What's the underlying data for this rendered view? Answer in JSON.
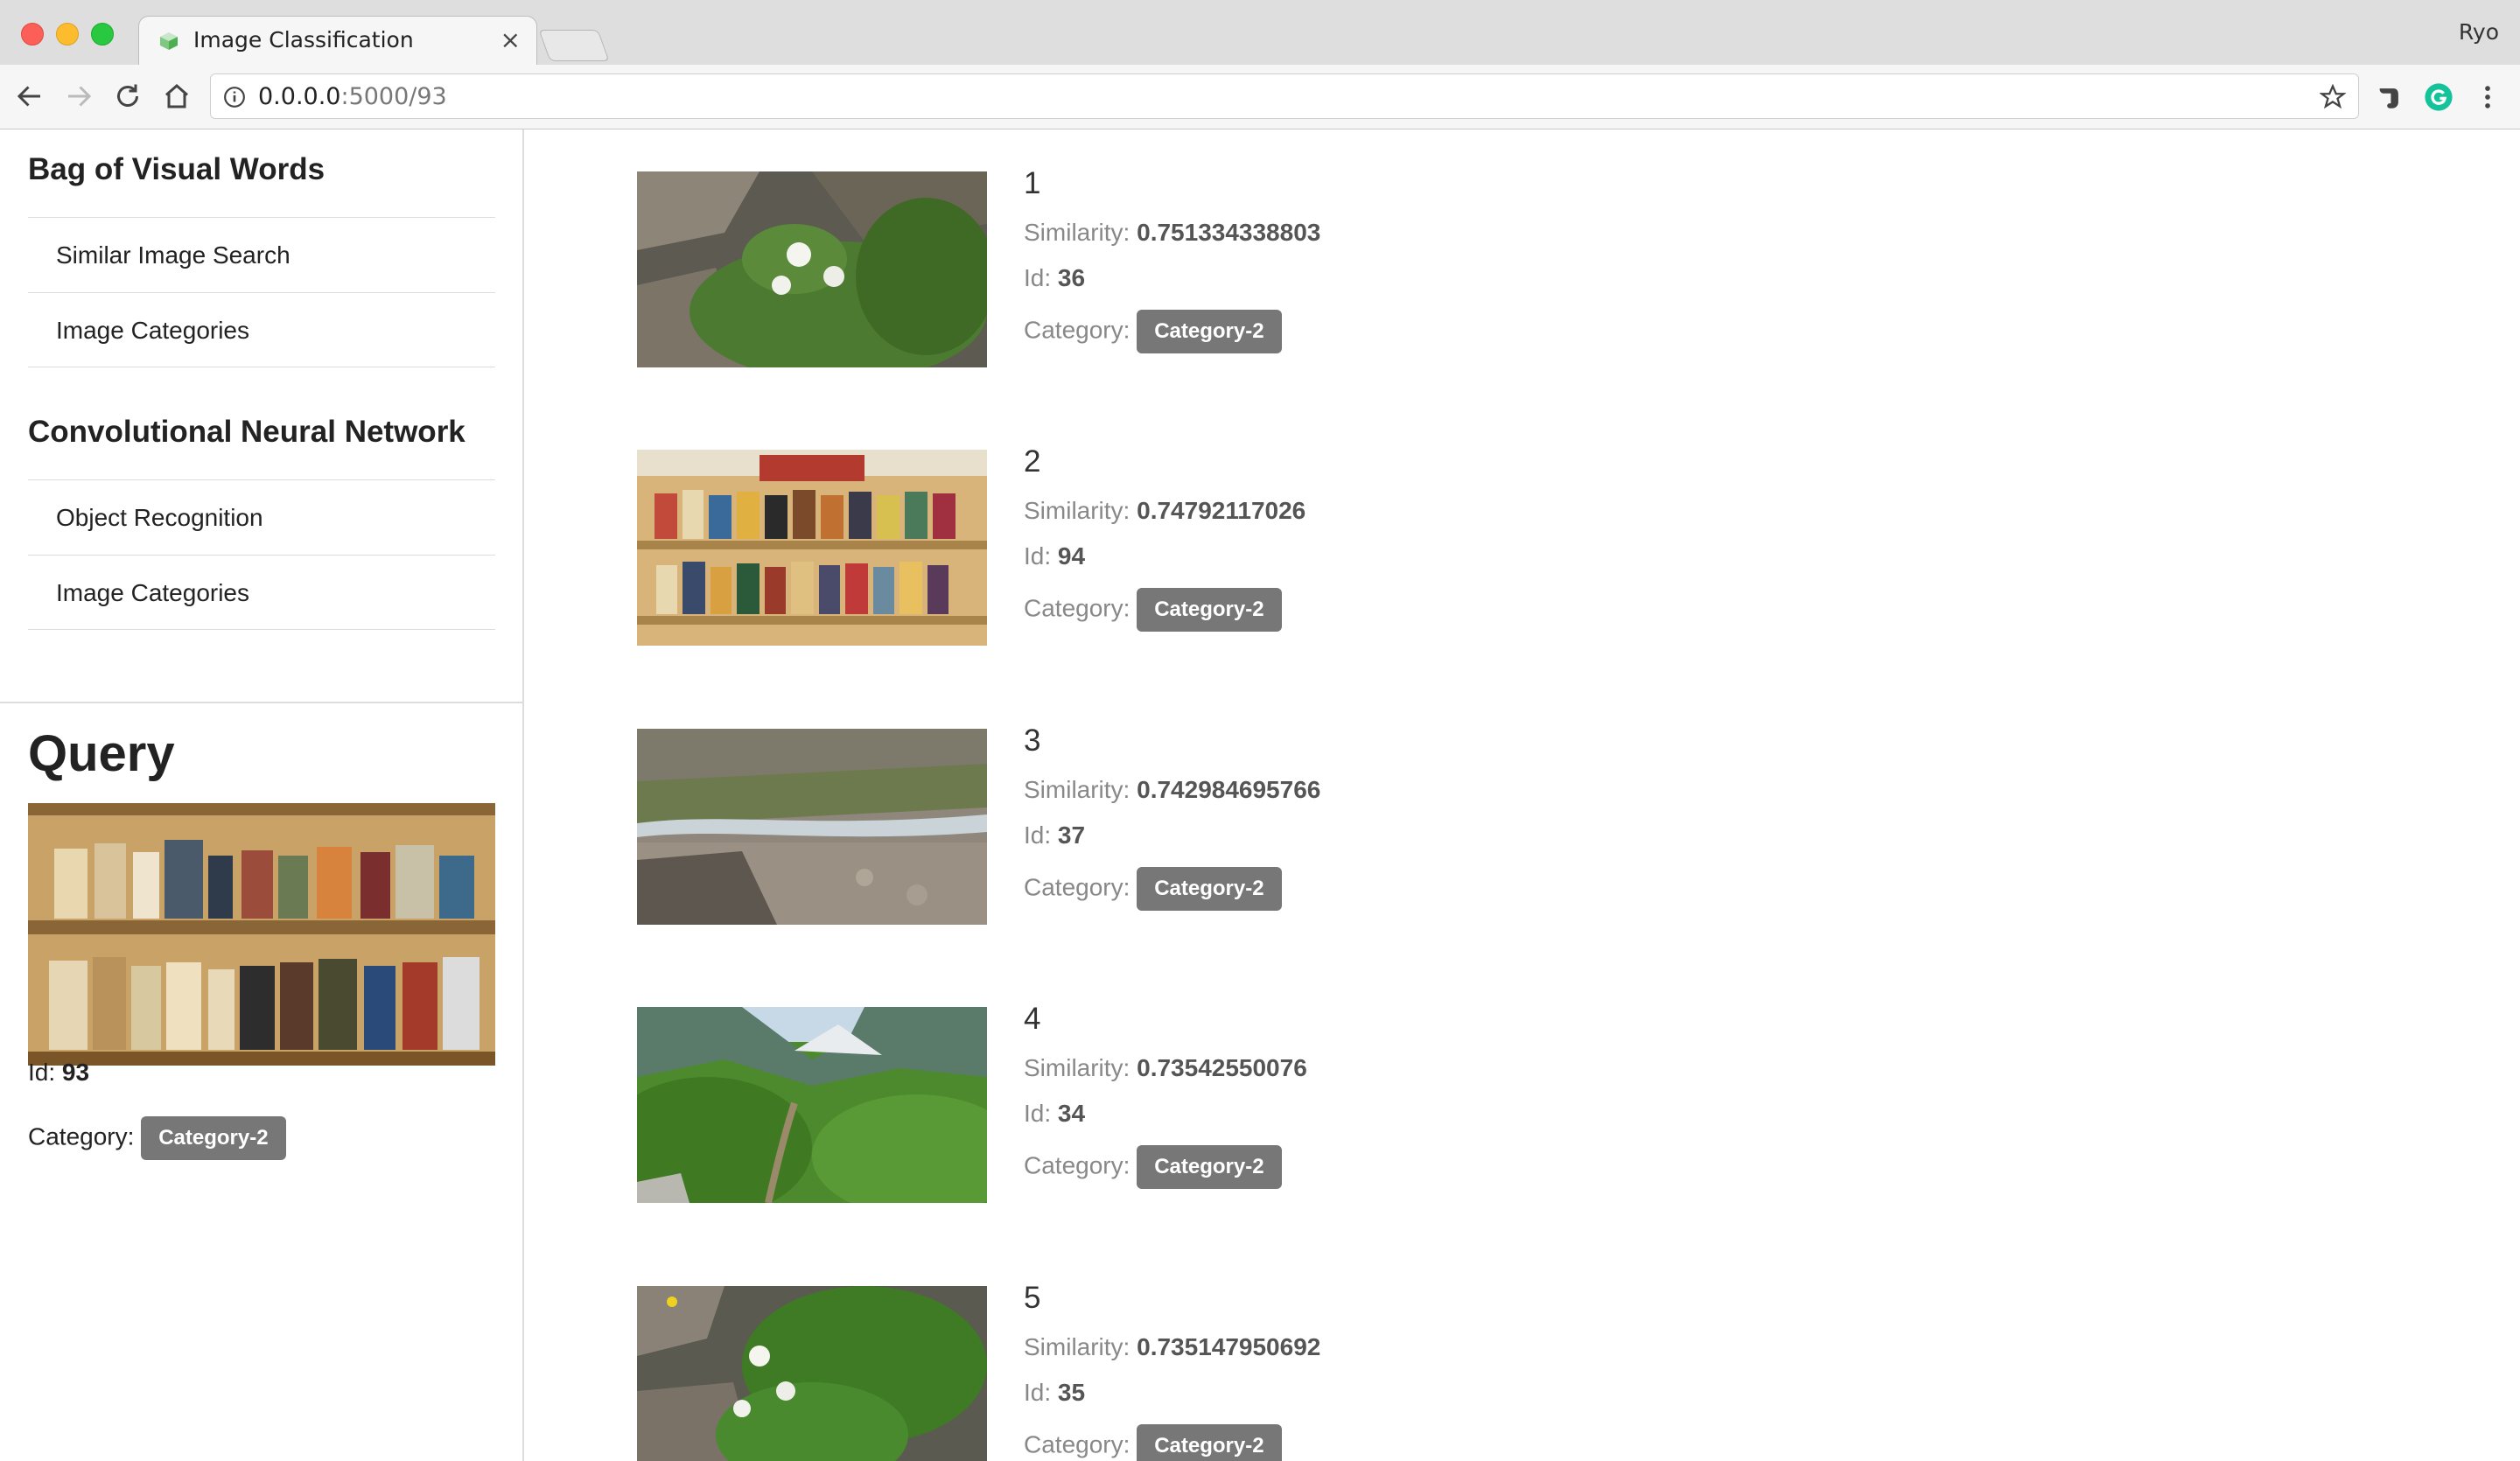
{
  "browser": {
    "tab_title": "Image Classification",
    "close_glyph": "×",
    "profile_name": "Ryo",
    "url_host": "0.0.0.0",
    "url_path": ":5000/93"
  },
  "sidebar": {
    "bovw_title": "Bag of Visual Words",
    "bovw_items": [
      "Similar Image Search",
      "Image Categories"
    ],
    "cnn_title": "Convolutional Neural Network",
    "cnn_items": [
      "Object Recognition",
      "Image Categories"
    ]
  },
  "query": {
    "title": "Query",
    "id_label": "Id:",
    "id": "93",
    "category_label": "Category:",
    "category": "Category-2"
  },
  "labels": {
    "similarity": "Similarity:",
    "id": "Id:",
    "category": "Category:"
  },
  "results": [
    {
      "rank": "1",
      "similarity": "0.751334338803",
      "id": "36",
      "category": "Category-2",
      "image": "flowers-rocks"
    },
    {
      "rank": "2",
      "similarity": "0.74792117026",
      "id": "94",
      "category": "Category-2",
      "image": "bookshelf"
    },
    {
      "rank": "3",
      "similarity": "0.742984695766",
      "id": "37",
      "category": "Category-2",
      "image": "rocky-stream"
    },
    {
      "rank": "4",
      "similarity": "0.73542550076",
      "id": "34",
      "category": "Category-2",
      "image": "mountain-meadow"
    },
    {
      "rank": "5",
      "similarity": "0.735147950692",
      "id": "35",
      "category": "Category-2",
      "image": "flowers-rocks"
    }
  ],
  "colors": {
    "badge": "#777777",
    "sidebar_border": "#dddddd"
  }
}
